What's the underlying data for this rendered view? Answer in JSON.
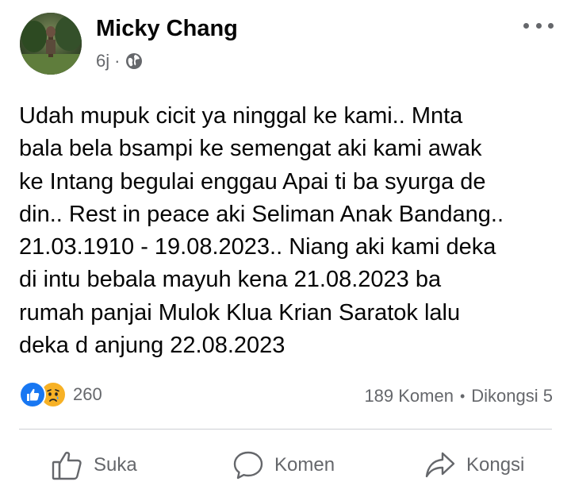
{
  "post": {
    "author": "Micky Chang",
    "time": "6j",
    "separator": "·",
    "text": "Udah mupuk cicit ya ninggal ke kami.. Mnta bala bela bsampi ke semengat aki kami awak ke Intang begulai enggau Apai ti ba syurga de din.. Rest in peace aki Seliman Anak Bandang.. 21.03.1910 - 19.08.2023.. Niang aki kami deka di intu bebala mayuh kena 21.08.2023 ba rumah panjai Mulok Klua Krian Saratok lalu deka d anjung 22.08.2023",
    "text_lines": [
      "Udah mupuk cicit ya ninggal ke kami.. Mnta",
      "bala bela bsampi ke semengat aki kami awak",
      "ke Intang begulai enggau Apai ti ba syurga de",
      "din.. Rest in peace aki Seliman Anak Bandang..",
      "21.03.1910 - 19.08.2023.. Niang aki kami deka",
      "di intu bebala mayuh kena 21.08.2023 ba",
      "rumah panjai Mulok Klua Krian Saratok lalu",
      "deka d anjung 22.08.2023"
    ]
  },
  "stats": {
    "reaction_count": "260",
    "comments": "189 Komen",
    "dot": "•",
    "shares": "Dikongsi 5"
  },
  "actions": {
    "like": "Suka",
    "comment": "Komen",
    "share": "Kongsi"
  },
  "icons": {
    "privacy": "globe-icon",
    "more": "more-options-icon",
    "like": "thumbs-up-icon",
    "comment": "comment-bubble-icon",
    "share": "share-arrow-icon"
  },
  "colors": {
    "text": "#050505",
    "muted": "#65676b",
    "like_blue": "#1877f2",
    "sad_yellow": "#f7b125",
    "divider": "#ced0d4"
  }
}
